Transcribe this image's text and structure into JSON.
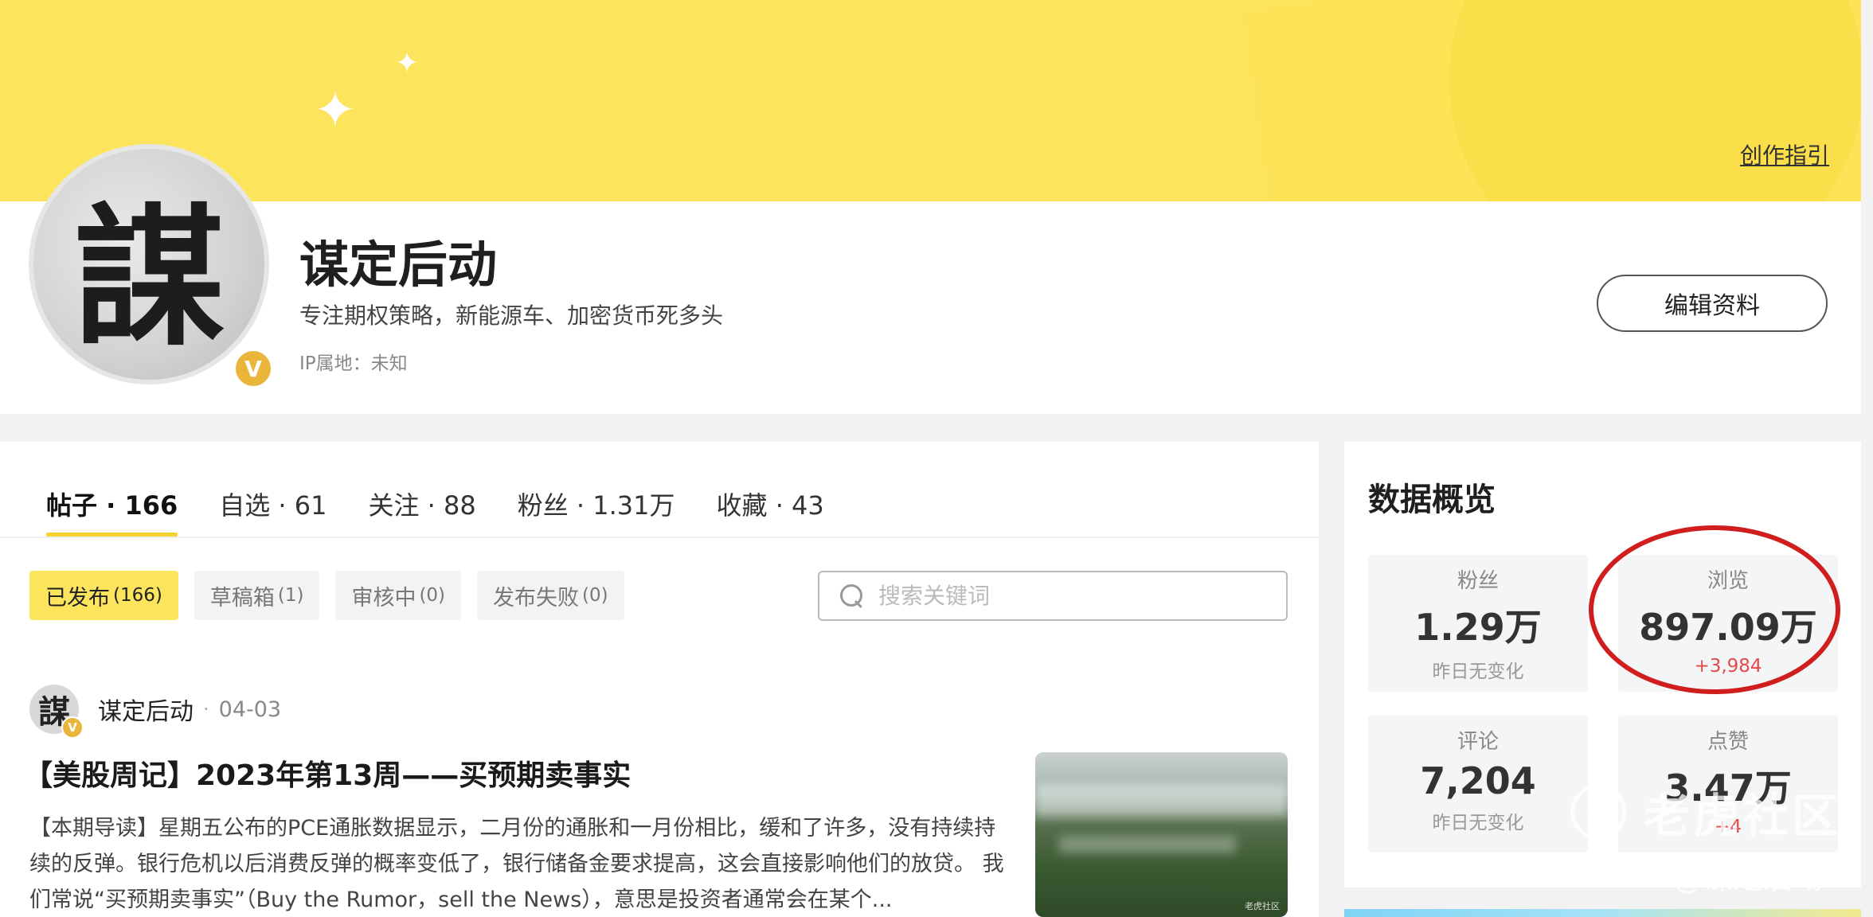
{
  "banner": {
    "guide_link": "创作指引"
  },
  "profile": {
    "avatar_glyph": "謀",
    "verified_badge": "V",
    "name": "谋定后动",
    "bio": "专注期权策略，新能源车、加密货币死多头",
    "ip_location": "IP属地：未知",
    "edit_button": "编辑资料"
  },
  "tabs": [
    {
      "label": "帖子 · 166",
      "active": true
    },
    {
      "label": "自选 · 61",
      "active": false
    },
    {
      "label": "关注 · 88",
      "active": false
    },
    {
      "label": "粉丝 · 1.31万",
      "active": false
    },
    {
      "label": "收藏 · 43",
      "active": false
    }
  ],
  "filters": [
    {
      "label": "已发布",
      "count": "(166)",
      "active": true
    },
    {
      "label": "草稿箱",
      "count": "(1)",
      "active": false
    },
    {
      "label": "审核中",
      "count": "(0)",
      "active": false
    },
    {
      "label": "发布失败",
      "count": "(0)",
      "active": false
    }
  ],
  "search": {
    "placeholder": "搜索关键词"
  },
  "post": {
    "author_glyph": "謀",
    "author": "谋定后动",
    "separator": "·",
    "date": "04-03",
    "title": "【美股周记】2023年第13周——买预期卖事实",
    "excerpt": "【本期导读】星期五公布的PCE通胀数据显示，二月份的通胀和一月份相比，缓和了许多，没有持续持续的反弹。银行危机以后消费反弹的概率变低了，银行储备金要求提高，这会直接影响他们的放贷。 我们常说“买预期卖事实”（Buy the Rumor，sell the News），意思是投资者通常会在某个...",
    "thumb_watermark": "老虎社区"
  },
  "overview": {
    "title": "数据概览",
    "stats": [
      {
        "label": "粉丝",
        "value": "1.29万",
        "change": "昨日无变化",
        "trend": "none"
      },
      {
        "label": "浏览",
        "value": "897.09万",
        "change": "+3,984",
        "trend": "up"
      },
      {
        "label": "评论",
        "value": "7,204",
        "change": "昨日无变化",
        "trend": "none"
      },
      {
        "label": "点赞",
        "value": "3.47万",
        "change": "+4",
        "trend": "up"
      }
    ]
  },
  "watermark": {
    "brand": "老虎社区",
    "user": "@谋定后动",
    "logo_glyph": "ω"
  },
  "colors": {
    "banner": "#fce55c",
    "accent": "#f5d32c",
    "highlight_ring": "#d01e1e",
    "up": "#e54a4a"
  }
}
